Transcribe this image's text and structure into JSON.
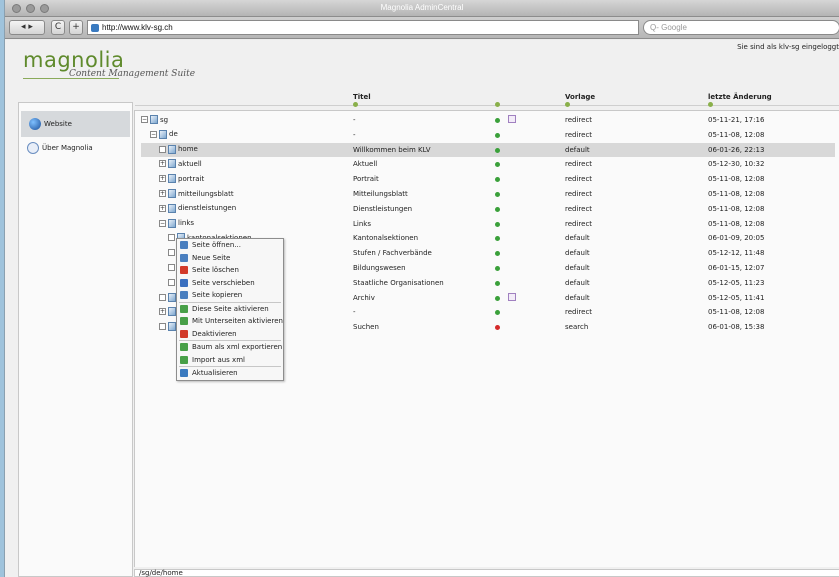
{
  "window": {
    "title": "Magnolia AdminCentral"
  },
  "browser": {
    "url": "http://www.klv-sg.ch",
    "search_placeholder": "Q- Google",
    "back": "◂ ▸",
    "reload": "C",
    "add": "+"
  },
  "header": {
    "logo_text": "magnolia",
    "logo_subtitle": "Content Management Suite",
    "logged_in": "Sie sind als klv-sg eingeloggt"
  },
  "sidebar": {
    "items": [
      {
        "label": "Website"
      },
      {
        "label": "Über Magnolia"
      }
    ]
  },
  "columns": {
    "title": "Titel",
    "template": "Vorlage",
    "modified": "letzte Änderung"
  },
  "rows": [
    {
      "name": "sg",
      "title": "-",
      "template": "redirect",
      "date": "05-11-21, 17:16",
      "tog": "⊟",
      "status": "green",
      "pencil": true
    },
    {
      "name": "de",
      "title": "-",
      "template": "redirect",
      "date": "05-11-08, 12:08",
      "tog": "⊟",
      "status": "green",
      "pencil": false
    },
    {
      "name": "home",
      "title": "Willkommen beim KLV",
      "template": "default",
      "date": "06-01-26, 22:13",
      "tog": "⊡",
      "status": "green",
      "pencil": false
    },
    {
      "name": "aktuell",
      "title": "Aktuell",
      "template": "redirect",
      "date": "05-12-30, 10:32",
      "tog": "⊞",
      "status": "green",
      "pencil": false
    },
    {
      "name": "portrait",
      "title": "Portrait",
      "template": "redirect",
      "date": "05-11-08, 12:08",
      "tog": "⊞",
      "status": "green",
      "pencil": false
    },
    {
      "name": "mitteilungsblatt",
      "title": "Mitteilungsblatt",
      "template": "redirect",
      "date": "05-11-08, 12:08",
      "tog": "⊞",
      "status": "green",
      "pencil": false
    },
    {
      "name": "dienstleistungen",
      "title": "Dienstleistungen",
      "template": "redirect",
      "date": "05-11-08, 12:08",
      "tog": "⊞",
      "status": "green",
      "pencil": false
    },
    {
      "name": "links",
      "title": "Links",
      "template": "redirect",
      "date": "05-11-08, 12:08",
      "tog": "⊟",
      "status": "green",
      "pencil": false
    },
    {
      "name": "kantonalsektionen",
      "title": "Kantonalsektionen",
      "template": "default",
      "date": "06-01-09, 20:05",
      "tog": "⊡",
      "status": "green",
      "pencil": false
    },
    {
      "name": "",
      "title": "Stufen / Fachverbände",
      "template": "default",
      "date": "05-12-12, 11:48",
      "tog": "⊡",
      "status": "green",
      "pencil": false
    },
    {
      "name": "",
      "title": "Bildungswesen",
      "template": "default",
      "date": "06-01-15, 12:07",
      "tog": "⊡",
      "status": "green",
      "pencil": false
    },
    {
      "name": "",
      "title": "Staatliche Organisationen",
      "template": "default",
      "date": "05-12-05, 11:23",
      "tog": "⊡",
      "status": "green",
      "pencil": false
    },
    {
      "name": "a",
      "title": "Archiv",
      "template": "default",
      "date": "05-12-05, 11:41",
      "tog": "⊡",
      "status": "green",
      "pencil": true
    },
    {
      "name": "a",
      "title": "-",
      "template": "redirect",
      "date": "05-11-08, 12:08",
      "tog": "⊞",
      "status": "green",
      "pencil": false
    },
    {
      "name": "s",
      "title": "Suchen",
      "template": "search",
      "date": "06-01-08, 15:38",
      "tog": "⊡",
      "status": "red",
      "pencil": false
    }
  ],
  "context_menu": [
    {
      "label": "Seite öffnen...",
      "icon": "open-page-icon",
      "color": "#4a7fbf"
    },
    {
      "label": "Neue Seite",
      "icon": "new-page-icon",
      "color": "#4a7fbf"
    },
    {
      "label": "Seite löschen",
      "icon": "delete-icon",
      "color": "#d23a2a"
    },
    {
      "label": "Seite verschieben",
      "icon": "move-icon",
      "color": "#3a6fbf"
    },
    {
      "label": "Seite kopieren",
      "icon": "copy-icon",
      "color": "#4a7fbf"
    },
    {
      "label": "Diese Seite aktivieren",
      "icon": "activate-icon",
      "color": "#48a048"
    },
    {
      "label": "Mit Unterseiten aktivieren",
      "icon": "activate-subpages-icon",
      "color": "#48a048"
    },
    {
      "label": "Deaktivieren",
      "icon": "deactivate-icon",
      "color": "#d23a2a"
    },
    {
      "label": "Baum als xml exportieren",
      "icon": "export-icon",
      "color": "#48a048"
    },
    {
      "label": "Import aus xml",
      "icon": "import-icon",
      "color": "#48a048"
    },
    {
      "label": "Aktualisieren",
      "icon": "refresh-icon",
      "color": "#3a7abf"
    }
  ],
  "status_bar": {
    "path": "/sg/de/home"
  },
  "colors": {
    "accent_green": "#5f8a2c",
    "status_green": "#3aa03a",
    "status_red": "#d42a2a"
  }
}
